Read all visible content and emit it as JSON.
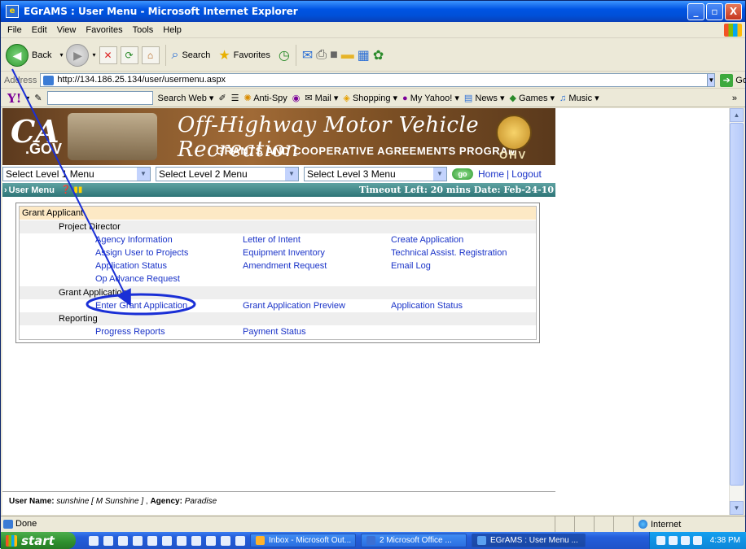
{
  "window": {
    "title": "EGrAMS : User Menu - Microsoft Internet Explorer",
    "controls": [
      "_",
      "▫",
      "X"
    ]
  },
  "menubar": [
    "File",
    "Edit",
    "View",
    "Favorites",
    "Tools",
    "Help"
  ],
  "toolbar": {
    "back": "Back",
    "search": "Search",
    "favorites": "Favorites"
  },
  "address": {
    "label": "Address",
    "url": "http://134.186.25.134/user/usermenu.aspx",
    "go": "Go"
  },
  "yahoo": {
    "search_web": "Search Web",
    "anti_spy": "Anti-Spy",
    "mail": "Mail",
    "shopping": "Shopping",
    "my_yahoo": "My Yahoo!",
    "news": "News",
    "games": "Games",
    "music": "Music"
  },
  "banner": {
    "ca": "CA",
    "gov": ".GOV",
    "title": "Off-Highway Motor Vehicle Recreation",
    "subtitle": "GRANTS AND COOPERATIVE AGREEMENTS PROGRAM",
    "ohv": "OHV"
  },
  "nav": {
    "level1": "Select Level 1 Menu",
    "level2": "Select Level 2 Menu",
    "level3": "Select Level 3 Menu",
    "go": "go",
    "home": "Home",
    "sep": "|",
    "logout": "Logout"
  },
  "strip": {
    "title": "User Menu",
    "timeout": "Timeout Left:  20  mins  Date: Feb-24-10"
  },
  "menu": {
    "group": "Grant Applicant",
    "sections": [
      {
        "label": "Project Director",
        "rows": [
          [
            "Agency Information",
            "Letter of Intent",
            "Create Application"
          ],
          [
            "Assign User to Projects",
            "Equipment Inventory",
            "Technical Assist. Registration"
          ],
          [
            "Application Status",
            "Amendment Request",
            "Email Log"
          ],
          [
            "Op Advance Request",
            "",
            ""
          ]
        ]
      },
      {
        "label": "Grant Application",
        "rows": [
          [
            "Enter Grant Application",
            "Grant Application Preview",
            "Application Status"
          ]
        ]
      },
      {
        "label": "Reporting",
        "rows": [
          [
            "Progress Reports",
            "Payment Status",
            ""
          ]
        ]
      }
    ]
  },
  "footer": {
    "user_label": "User Name:",
    "user_value": "sunshine [ M Sunshine ]",
    "sep": " ,",
    "agency_label": "Agency:",
    "agency_value": "Paradise"
  },
  "status": {
    "done": "Done",
    "zone": "Internet"
  },
  "taskbar": {
    "start": "start",
    "tasks": [
      "Inbox - Microsoft Out...",
      "2 Microsoft Office ...",
      "EGrAMS : User Menu ..."
    ],
    "clock": "4:38 PM"
  },
  "colors": {
    "link": "#1a33c8",
    "group_bg": "#fde9c5",
    "section_bg": "#eeeeee",
    "strip": "#2e7577",
    "annotation": "#1a2fd6"
  }
}
